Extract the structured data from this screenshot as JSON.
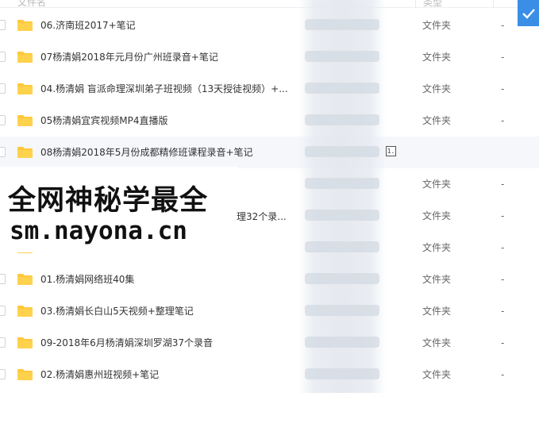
{
  "header": {
    "name_col": "文件名",
    "type_col": "类型"
  },
  "folder_type": "文件夹",
  "empty_size": "-",
  "rows": [
    {
      "name": "06.济南班2017+笔记",
      "type": "文件夹",
      "size": "-"
    },
    {
      "name": "07杨清娟2018年元月份广州班录音+笔记",
      "type": "文件夹",
      "size": "-"
    },
    {
      "name": "04.杨清娟 盲派命理深圳弟子班视频（13天授徒视频）+...",
      "type": "文件夹",
      "size": "-"
    },
    {
      "name": "05杨清娟宜宾视频MP4直播版",
      "type": "文件夹",
      "size": "-"
    },
    {
      "name": "08杨清娟2018年5月份成都精修班课程录音+笔记",
      "type": "",
      "size": "",
      "action_icon": "1."
    },
    {
      "name": "",
      "type": "文件夹",
      "size": "-"
    },
    {
      "name": "",
      "type": "文件夹",
      "size": "-"
    },
    {
      "name": "",
      "type": "文件夹",
      "size": "-"
    },
    {
      "name": "01.杨清娟网络班40集",
      "type": "文件夹",
      "size": "-"
    },
    {
      "name": "03.杨清娟长白山5天视频+整理笔记",
      "type": "文件夹",
      "size": "-"
    },
    {
      "name": "09-2018年6月杨清娟深圳罗湖37个录音",
      "type": "文件夹",
      "size": "-"
    },
    {
      "name": "02.杨清娟惠州班视频+笔记",
      "type": "文件夹",
      "size": "-"
    }
  ],
  "partial_text": "理32个录...",
  "watermark": {
    "line1": "全网神秘学最全",
    "line2": "sm.nayona.cn"
  },
  "colors": {
    "accent": "#3a8ee6",
    "folder": "#ffc83d",
    "folder_tab": "#f5b81f"
  }
}
